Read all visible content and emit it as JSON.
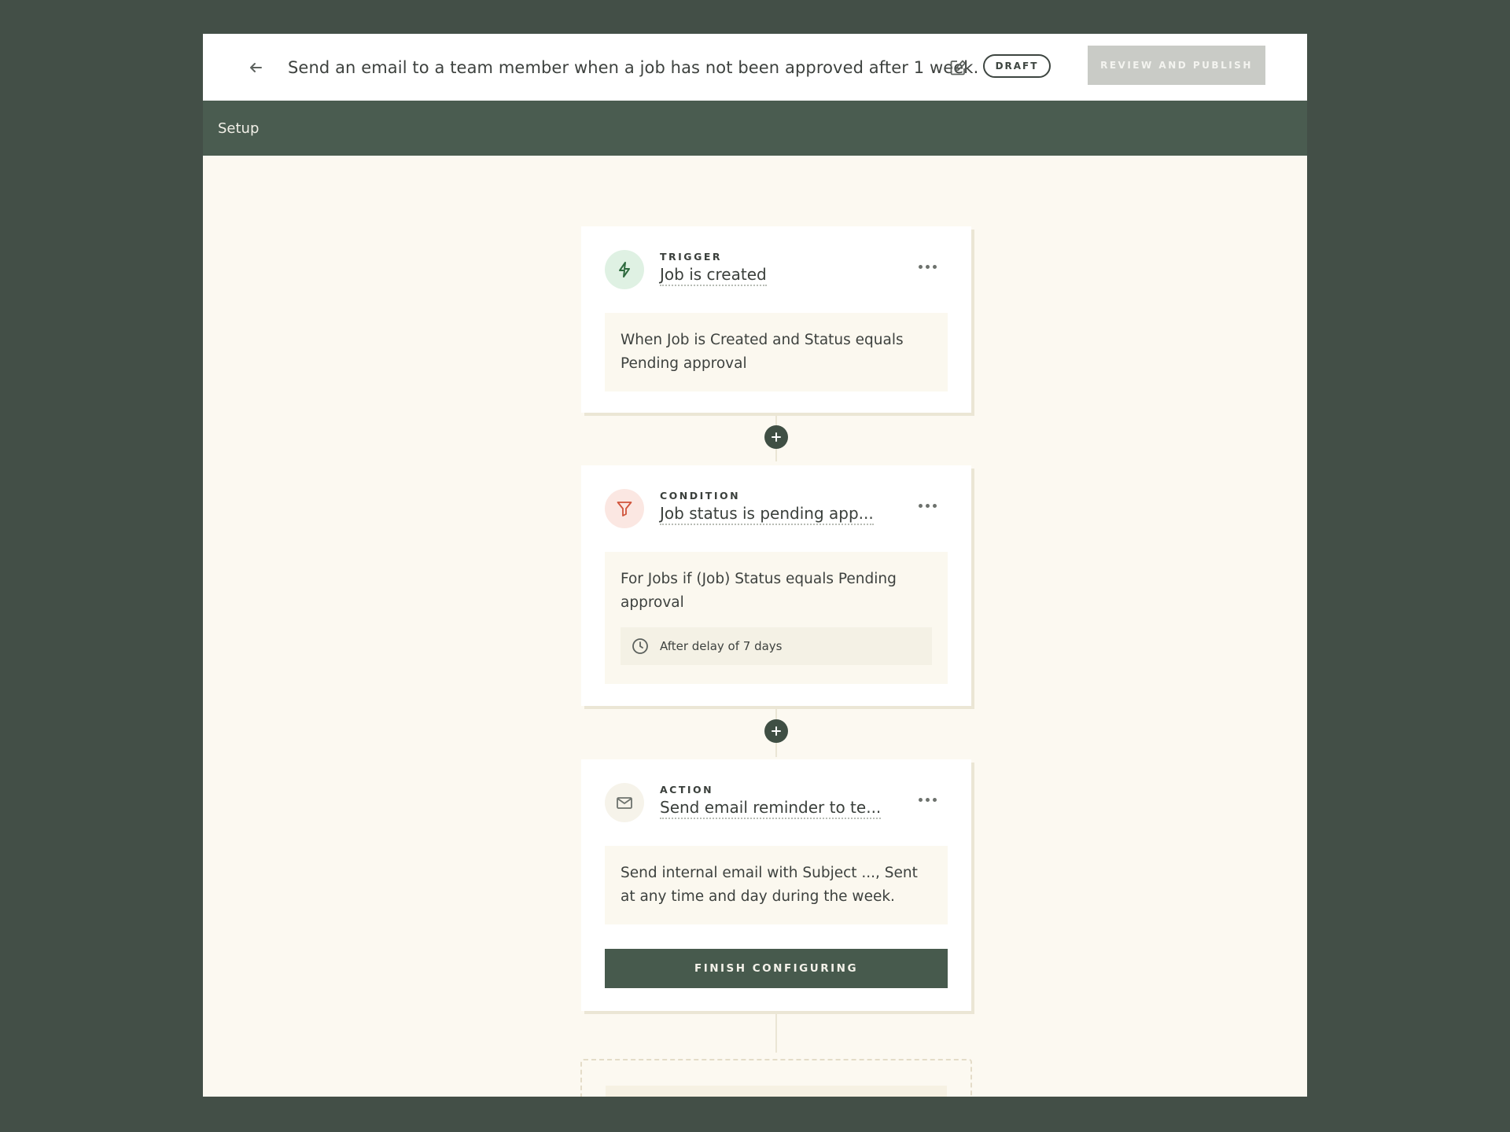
{
  "header": {
    "title": "Send an email to a team member when a job has not been approved after 1 week.",
    "status_badge": "DRAFT",
    "publish_label": "REVIEW AND PUBLISH"
  },
  "subnav": {
    "label": "Setup"
  },
  "workflow": {
    "trigger": {
      "type_label": "TRIGGER",
      "name": "Job is created",
      "description": "When Job is Created and Status equals Pending approval",
      "icon": "lightning-icon"
    },
    "condition": {
      "type_label": "CONDITION",
      "name": "Job status is pending app...",
      "description": "For Jobs if (Job) Status equals Pending approval",
      "delay": "After delay of 7 days",
      "icon": "filter-icon"
    },
    "action": {
      "type_label": "ACTION",
      "name": "Send email reminder to te...",
      "description": "Send internal email with Subject ..., Sent at any time and day during the week.",
      "finish_label": "FINISH CONFIGURING",
      "icon": "mail-icon"
    }
  },
  "colors": {
    "background": "#434f47",
    "canvas": "#fcf9f1",
    "subbar": "#4a5c50",
    "primary_button": "#475a4d",
    "disabled_button": "#c9cbc6"
  }
}
